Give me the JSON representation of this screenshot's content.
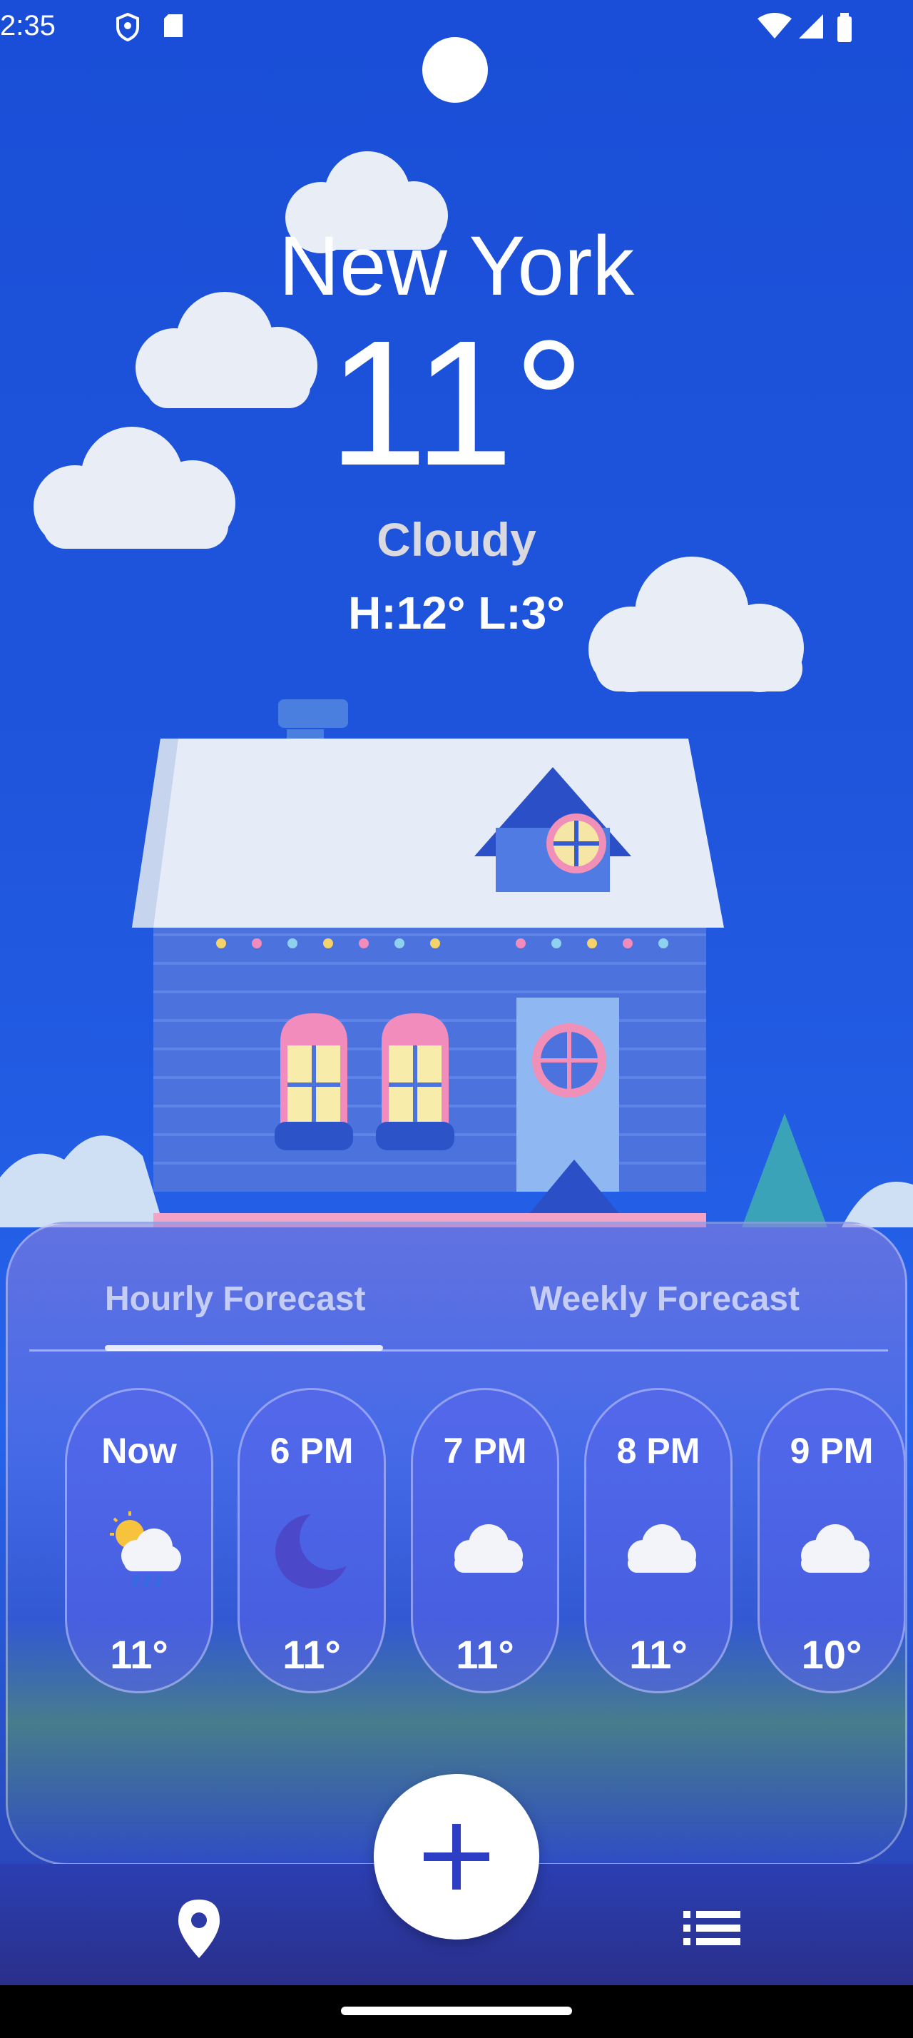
{
  "status_bar": {
    "time": "2:35",
    "icons": [
      "shield-icon",
      "sd-card-icon",
      "wifi-icon",
      "cell-signal-icon",
      "battery-icon"
    ]
  },
  "location": {
    "city": "New York"
  },
  "current": {
    "temperature": "11°",
    "condition": "Cloudy",
    "high_low": "H:12° L:3°"
  },
  "tabs": [
    {
      "label": "Hourly Forecast",
      "selected": true
    },
    {
      "label": "Weekly Forecast",
      "selected": false
    }
  ],
  "hourly": [
    {
      "label": "Now",
      "icon": "rain-sun-cloud-icon",
      "temp": "11°"
    },
    {
      "label": "6 PM",
      "icon": "moon-icon",
      "temp": "11°"
    },
    {
      "label": "7 PM",
      "icon": "cloud-icon",
      "temp": "11°"
    },
    {
      "label": "8 PM",
      "icon": "cloud-icon",
      "temp": "11°"
    },
    {
      "label": "9 PM",
      "icon": "cloud-icon",
      "temp": "10°"
    }
  ],
  "bottom_nav": {
    "left_icon": "location-pin-icon",
    "center_icon": "plus-icon",
    "right_icon": "list-icon"
  },
  "colors": {
    "sky": "#1a4ed8",
    "accent": "#2c3ec6",
    "card": "#5a64eb",
    "condition_text": "#d9d9df"
  }
}
